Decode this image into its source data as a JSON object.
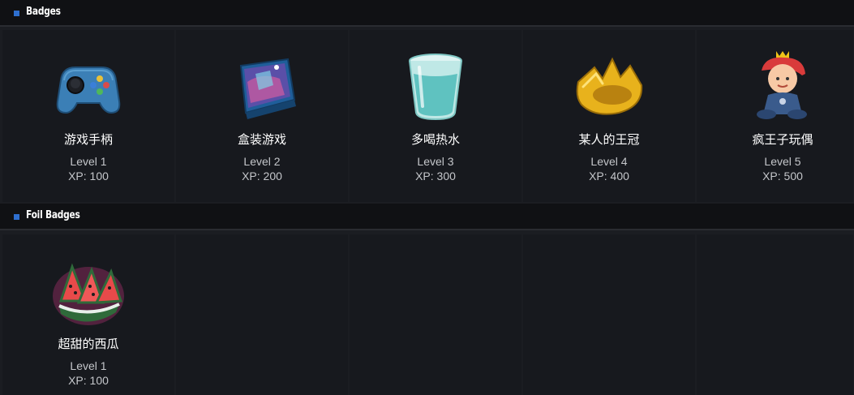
{
  "sections": [
    {
      "title": "Badges",
      "badges": [
        {
          "name": "游戏手柄",
          "level": "Level 1",
          "xp": "XP: 100",
          "icon": "gamepad-icon"
        },
        {
          "name": "盒装游戏",
          "level": "Level 2",
          "xp": "XP: 200",
          "icon": "game-box-icon"
        },
        {
          "name": "多喝热水",
          "level": "Level 3",
          "xp": "XP: 300",
          "icon": "water-glass-icon"
        },
        {
          "name": "某人的王冠",
          "level": "Level 4",
          "xp": "XP: 400",
          "icon": "crown-icon"
        },
        {
          "name": "疯王子玩偶",
          "level": "Level 5",
          "xp": "XP: 500",
          "icon": "prince-doll-icon"
        }
      ]
    },
    {
      "title": "Foil Badges",
      "badges": [
        {
          "name": "超甜的西瓜",
          "level": "Level 1",
          "xp": "XP: 100",
          "icon": "watermelon-icon"
        }
      ]
    }
  ],
  "colors": {
    "accent": "#2e6fcf",
    "header_bg": "#101114",
    "tile_bg": "#17191e",
    "page_bg": "#1b1d22"
  }
}
